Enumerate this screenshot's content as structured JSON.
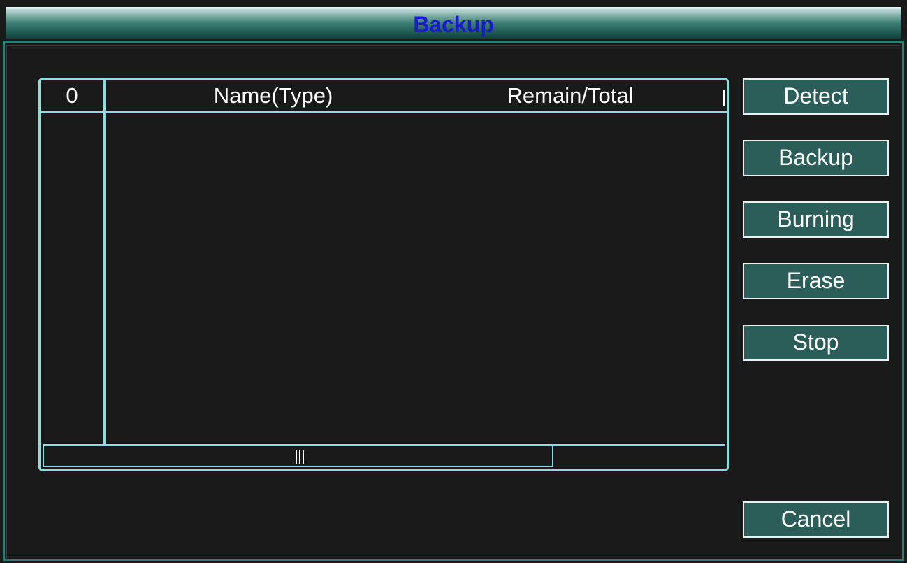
{
  "window": {
    "title": "Backup"
  },
  "table": {
    "headers": {
      "index": "0",
      "name_type": "Name(Type)",
      "remain_total": "Remain/Total"
    },
    "rows": []
  },
  "buttons": {
    "detect": "Detect",
    "backup": "Backup",
    "burning": "Burning",
    "erase": "Erase",
    "stop": "Stop",
    "cancel": "Cancel"
  },
  "colors": {
    "title_text": "#1a1ad6",
    "table_border": "#7fe3e3",
    "button_bg": "#2b5e58",
    "panel_bg": "#1a1a1a"
  }
}
